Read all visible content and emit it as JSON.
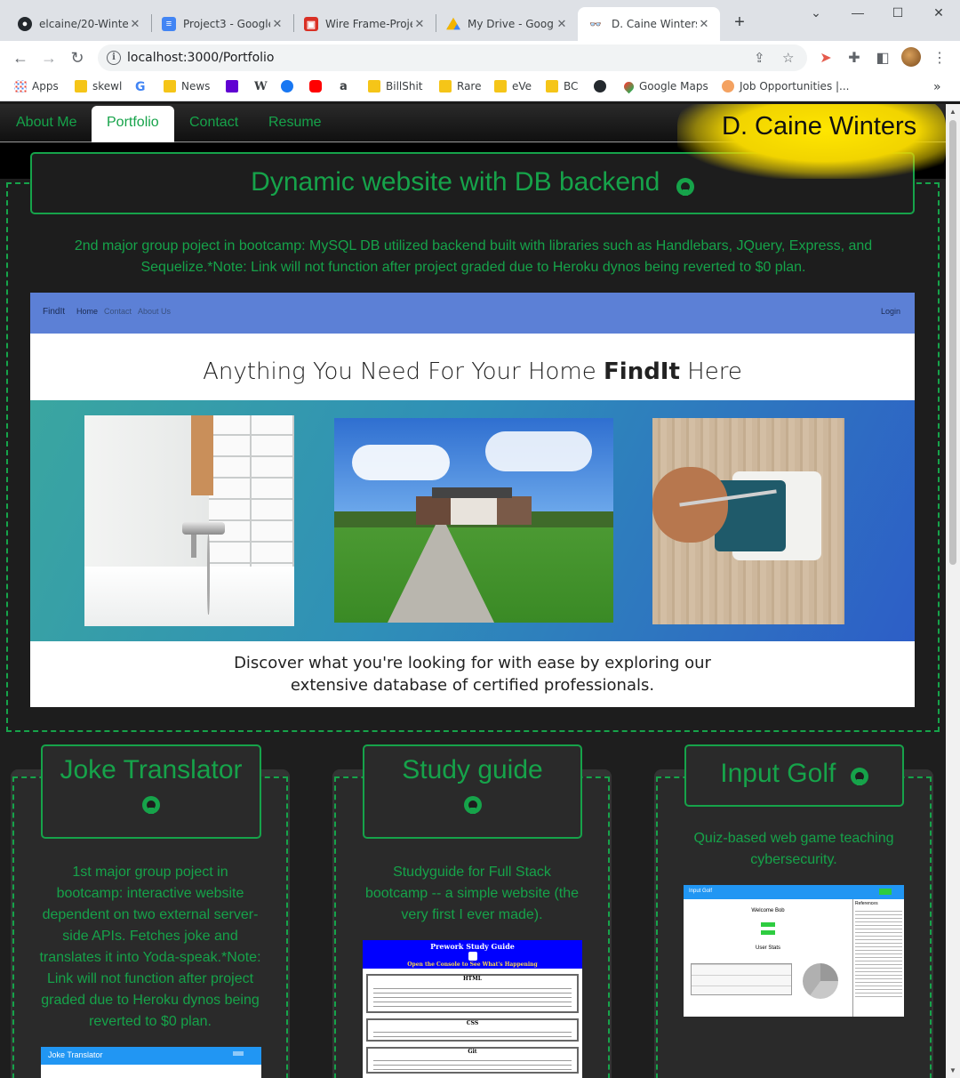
{
  "browser": {
    "tabs": [
      {
        "title": "elcaine/20-Winter",
        "icon": "github-icon"
      },
      {
        "title": "Project3 - Google",
        "icon": "docs-icon"
      },
      {
        "title": "Wire Frame-Proje",
        "icon": "figma-icon"
      },
      {
        "title": "My Drive - Googl",
        "icon": "drive-icon"
      },
      {
        "title": "D. Caine Winters",
        "icon": "glasses-icon"
      }
    ],
    "url": "localhost:3000/Portfolio",
    "bookmarks": [
      "Apps",
      "skewl",
      "News",
      "BillShit",
      "Rare",
      "eVe",
      "BC",
      "Google Maps",
      "Job Opportunities |..."
    ]
  },
  "site": {
    "nav": [
      "About Me",
      "Portfolio",
      "Contact",
      "Resume"
    ],
    "brand": "D. Caine Winters",
    "feature": {
      "title": "Dynamic website with DB backend",
      "description": "2nd major group poject in bootcamp: MySQL DB utilized backend built with libraries such as Handlebars, JQuery, Express, and Sequelize.*Note: Link will not function after project graded due to Heroku dynos being reverted to $0 plan.",
      "preview": {
        "logo": "FindIt",
        "nav": [
          "Home",
          "Contact",
          "About Us"
        ],
        "login": "Login",
        "headline_pre": "Anything You Need For Your Home ",
        "headline_bold": "FindIt",
        "headline_post": " Here",
        "tagline": "Discover what you're looking for with ease by exploring our extensive database of certified professionals."
      }
    },
    "cards": [
      {
        "title": "Joke Translator",
        "description": "1st major group poject in bootcamp: interactive website dependent on two external server-side APIs. Fetches joke and translates it into Yoda-speak.*Note: Link will not function after project graded due to Heroku dynos being reverted to $0 plan.",
        "preview_title": "Joke Translator"
      },
      {
        "title": "Study guide",
        "description": "Studyguide for Full Stack bootcamp -- a simple website (the very first I ever made).",
        "preview_title": "Prework Study Guide",
        "preview_sub": "Open the Console to See What's Happening",
        "sections": [
          "HTML",
          "CSS",
          "Git"
        ]
      },
      {
        "title": "Input Golf",
        "description": "Quiz-based web game teaching cybersecurity.",
        "preview_title": "Input Golf",
        "preview_welcome": "Welcome Bob",
        "preview_stats": "User Stats",
        "preview_refs": "References"
      }
    ]
  }
}
